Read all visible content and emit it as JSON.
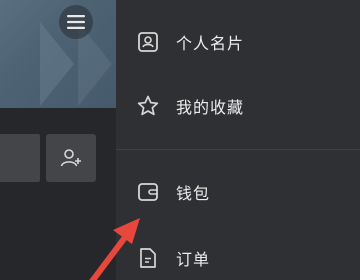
{
  "menu": {
    "items": [
      {
        "label": "个人名片",
        "icon": "profile-card-icon"
      },
      {
        "label": "我的收藏",
        "icon": "star-icon"
      },
      {
        "label": "钱包",
        "icon": "wallet-icon"
      },
      {
        "label": "订单",
        "icon": "order-document-icon"
      }
    ]
  },
  "background": {
    "menu_icon": "hamburger-menu-icon",
    "add_friend_icon": "add-person-icon"
  },
  "annotation": {
    "color": "#e8473c",
    "points_to": "钱包"
  }
}
